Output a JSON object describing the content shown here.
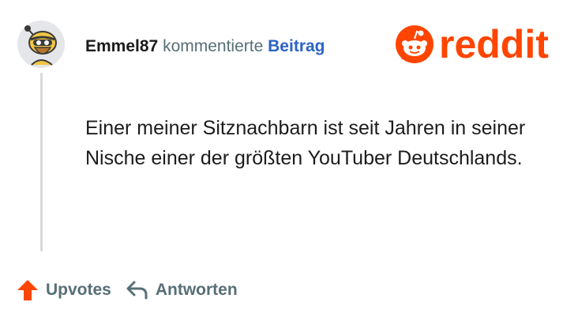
{
  "comment": {
    "author": "Emmel87",
    "action_text": "kommentierte",
    "post_link": "Beitrag",
    "body": "Einer meiner Sitznachbarn ist seit Jahren in seiner Nische einer der größten YouTuber Deutschlands."
  },
  "brand": {
    "wordmark": "reddit",
    "color": "#ff4500"
  },
  "actions": {
    "upvote_label": "Upvotes",
    "reply_label": "Antworten"
  },
  "colors": {
    "accent_link": "#2b63c6",
    "upvote_orange": "#ff4500",
    "muted_text": "#576f76"
  },
  "icons": {
    "avatar": "snoo-avatar",
    "upvote": "upvote-arrow-icon",
    "reply": "reply-arrow-icon",
    "logo": "reddit-snoo-icon"
  }
}
